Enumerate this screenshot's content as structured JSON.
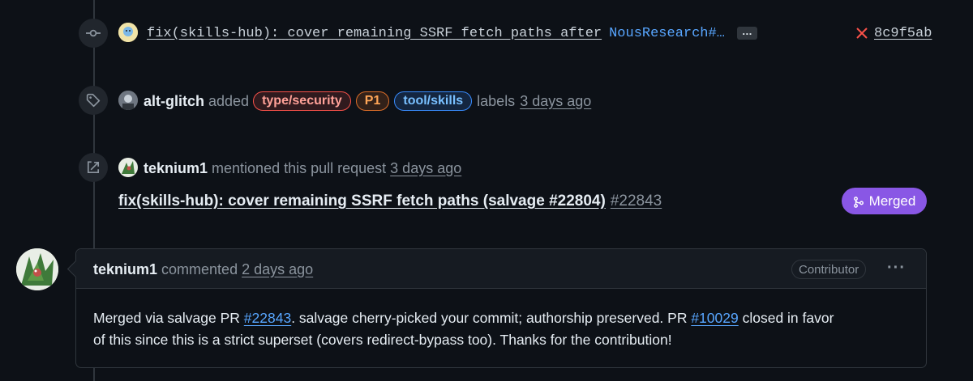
{
  "commit": {
    "message": "fix(skills-hub): cover remaining SSRF fetch paths after",
    "ref_link": "NousResearch#…",
    "more_label": "…",
    "status_icon": "x-icon",
    "sha": "8c9f5ab"
  },
  "labels_event": {
    "author": "alt-glitch",
    "verb": "added",
    "labels": [
      {
        "name": "type/security",
        "color": "#f85149"
      },
      {
        "name": "P1",
        "color": "#db6d28"
      },
      {
        "name": "tool/skills",
        "color": "#58a6ff"
      }
    ],
    "suffix": "labels",
    "time": "3 days ago"
  },
  "mention_event": {
    "author": "teknium1",
    "text": "mentioned this pull request",
    "time": "3 days ago",
    "pr_title": "fix(skills-hub): cover remaining SSRF fetch paths (salvage #22804)",
    "pr_number": "#22843",
    "status_label": "Merged",
    "status_color": "#8957e5"
  },
  "comment": {
    "author": "teknium1",
    "verb": "commented",
    "time": "2 days ago",
    "badge": "Contributor",
    "menu_label": "···",
    "body_1": "Merged via salvage PR ",
    "link_1": "#22843",
    "body_2": ". salvage cherry-picked your commit; authorship preserved. PR ",
    "link_2": "#10029",
    "body_3": " closed in favor",
    "body_4": "of this since this is a strict superset (covers redirect-bypass too). Thanks for the contribution!"
  }
}
